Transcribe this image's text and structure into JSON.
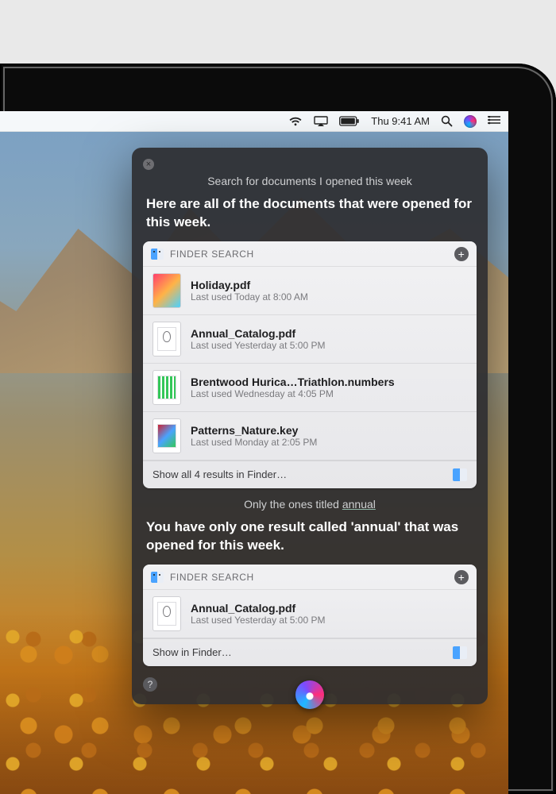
{
  "menubar": {
    "clock": "Thu 9:41 AM"
  },
  "siri": {
    "query1": "Search for documents I opened this week",
    "response1": "Here are all of the documents that were opened for this week.",
    "query2_prefix": "Only the ones titled ",
    "query2_underlined": "annual",
    "response2": "You have only one result called 'annual' that was opened for this week."
  },
  "card1": {
    "header": "FINDER SEARCH",
    "footer": "Show all 4 results in Finder…",
    "rows": [
      {
        "name": "Holiday.pdf",
        "used": "Last used Today at 8:00 AM"
      },
      {
        "name": "Annual_Catalog.pdf",
        "used": "Last used Yesterday at 5:00 PM"
      },
      {
        "name": "Brentwood Hurica…Triathlon.numbers",
        "used": "Last used Wednesday at 4:05 PM"
      },
      {
        "name": "Patterns_Nature.key",
        "used": "Last used Monday at 2:05 PM"
      }
    ]
  },
  "card2": {
    "header": "FINDER SEARCH",
    "footer": "Show in Finder…",
    "rows": [
      {
        "name": "Annual_Catalog.pdf",
        "used": "Last used Yesterday at 5:00 PM"
      }
    ]
  }
}
